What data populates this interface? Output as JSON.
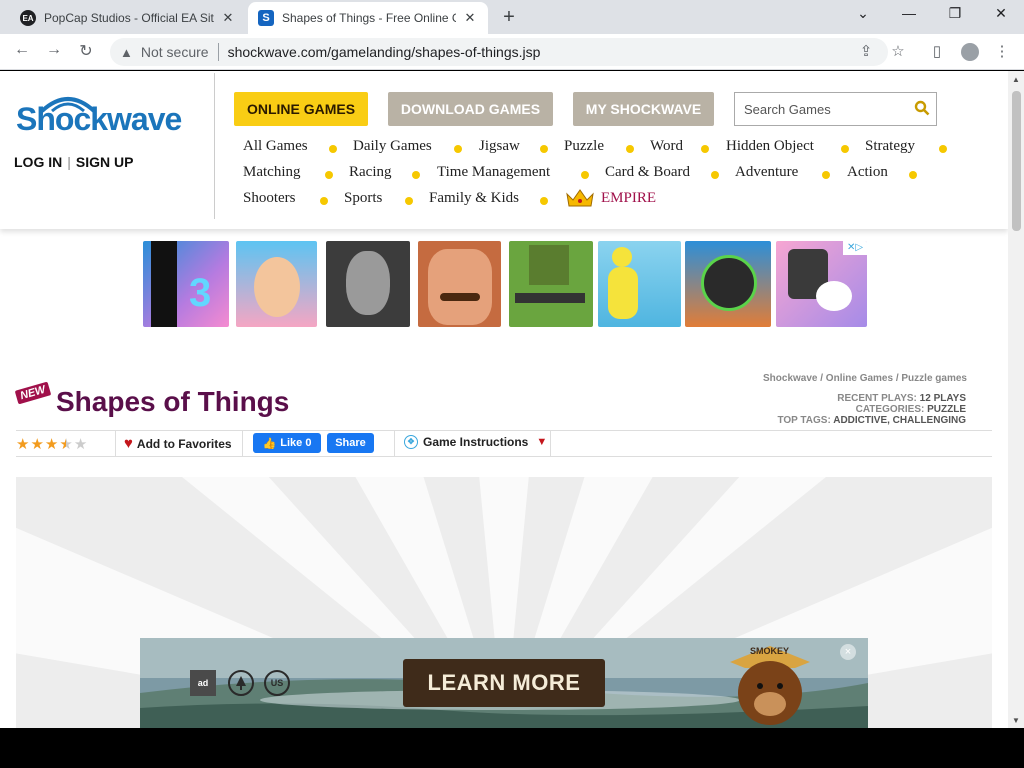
{
  "browser": {
    "tabs": [
      {
        "title": "PopCap Studios - Official EA Site",
        "icon": "ea-logo-icon",
        "active": false
      },
      {
        "title": "Shapes of Things - Free Online G",
        "icon": "shockwave-favicon-icon",
        "active": true
      }
    ],
    "new_tab": "+",
    "window_controls": {
      "dropdown": "⌄",
      "minimize": "—",
      "restore": "❐",
      "close": "✕"
    },
    "security_label": "Not secure",
    "url": "shockwave.com/gamelanding/shapes-of-things.jsp",
    "nav": {
      "back": "←",
      "forward": "→",
      "reload": "↻"
    },
    "toolbar_icons": {
      "share": "⇪",
      "bookmark": "☆",
      "sidepanel": "▯",
      "menu": "⋮"
    }
  },
  "site": {
    "logo_text": "Shockwave",
    "auth": {
      "login": "LOG IN",
      "separator": "|",
      "signup": "SIGN UP"
    },
    "top_buttons": {
      "online": "ONLINE GAMES",
      "download": "DOWNLOAD GAMES",
      "my": "MY SHOCKWAVE"
    },
    "search": {
      "placeholder": "Search Games"
    },
    "categories": [
      "All Games",
      "Daily Games",
      "Jigsaw",
      "Puzzle",
      "Word",
      "Hidden Object",
      "Strategy",
      "Matching",
      "Racing",
      "Time Management",
      "Card & Board",
      "Adventure",
      "Action",
      "Shooters",
      "Sports",
      "Family & Kids"
    ],
    "empire_label": "EMPIRE",
    "ad_close": "✕▷"
  },
  "game": {
    "badge": "NEW",
    "title": "Shapes of Things",
    "breadcrumb": "Shockwave / Online Games / Puzzle games",
    "stats": {
      "recent_plays_key": "RECENT PLAYS:",
      "recent_plays_val": "12 PLAYS",
      "categories_key": "CATEGORIES:",
      "categories_val": "PUZZLE",
      "top_tags_key": "TOP TAGS:",
      "top_tags_val": "ADDICTIVE, CHALLENGING"
    },
    "rating": 3.5,
    "rating_max": 5,
    "favorites_label": "Add to Favorites",
    "like_label": "Like 0",
    "share_label": "Share",
    "instructions_label": "Game Instructions"
  },
  "bottom_ad": {
    "cta": "LEARN MORE",
    "hat_text": "SMOKEY",
    "logos": [
      "ad",
      "forest-logo",
      "US"
    ],
    "close": "×"
  },
  "colors": {
    "online_btn": "#f9cd14",
    "inactive_btn": "#b9b2a5",
    "title": "#5a0f4a",
    "empire": "#a0104a",
    "category_dot": "#f6c800",
    "logo_blue": "#1b75bb"
  }
}
